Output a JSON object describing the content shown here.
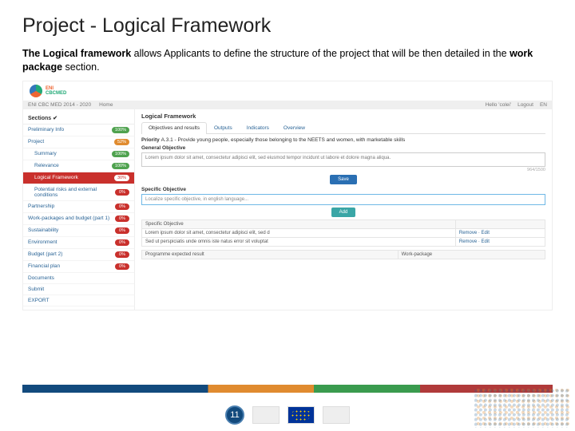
{
  "slide": {
    "title": "Project - Logical Framework",
    "intro_a": "The Logical framework",
    "intro_b": " allows Applicants to define the structure of the project that will be then detailed in the ",
    "intro_c": "work package",
    "intro_d": " section.",
    "page_number": "11"
  },
  "header": {
    "brand1": "ENI",
    "brand2": "CBCMED",
    "programme": "ENI CBC MED 2014 - 2020",
    "home": "Home",
    "hello": "Hello 'colei'",
    "logout": "Logout",
    "lang": "EN"
  },
  "sidebar": {
    "title": "Sections ✔",
    "items": [
      {
        "label": "Preliminary Info",
        "pct": "100%",
        "cls": "bg-green",
        "indent": false,
        "active": false
      },
      {
        "label": "Project",
        "pct": "52%",
        "cls": "bg-orange",
        "indent": false,
        "active": false
      },
      {
        "label": "Summary",
        "pct": "100%",
        "cls": "bg-green",
        "indent": true,
        "active": false
      },
      {
        "label": "Relevance",
        "pct": "100%",
        "cls": "bg-green",
        "indent": true,
        "active": false
      },
      {
        "label": "Logical Framework",
        "pct": "30%",
        "cls": "bg-white",
        "indent": true,
        "active": true
      },
      {
        "label": "Potential risks and external conditions",
        "pct": "0%",
        "cls": "bg-red",
        "indent": true,
        "active": false
      },
      {
        "label": "Partnership",
        "pct": "0%",
        "cls": "bg-red",
        "indent": false,
        "active": false
      },
      {
        "label": "Work-packages and budget (part 1)",
        "pct": "0%",
        "cls": "bg-red",
        "indent": false,
        "active": false
      },
      {
        "label": "Sustainability",
        "pct": "0%",
        "cls": "bg-red",
        "indent": false,
        "active": false
      },
      {
        "label": "Environment",
        "pct": "0%",
        "cls": "bg-red",
        "indent": false,
        "active": false
      },
      {
        "label": "Budget (part 2)",
        "pct": "0%",
        "cls": "bg-red",
        "indent": false,
        "active": false
      },
      {
        "label": "Financial plan",
        "pct": "0%",
        "cls": "bg-red",
        "indent": false,
        "active": false
      },
      {
        "label": "Documents",
        "pct": "",
        "cls": "",
        "indent": false,
        "active": false
      },
      {
        "label": "Submit",
        "pct": "",
        "cls": "",
        "indent": false,
        "active": false
      },
      {
        "label": "EXPORT",
        "pct": "",
        "cls": "",
        "indent": false,
        "active": false
      }
    ]
  },
  "main": {
    "panel": "Logical Framework",
    "tabs": [
      "Objectives and results",
      "Outputs",
      "Indicators",
      "Overview"
    ],
    "active_tab": 0,
    "priority_label": "Priority",
    "priority_text": "A.3.1 - Provide young people, especially those belonging to the NEETS and women, with marketable skills",
    "general_label": "General Objective",
    "general_text": "Lorem ipsum dolor sit amet, consectetur adipisci elit, sed eiusmod tempor incidunt ut labore et dolore magna aliqua.",
    "char_count": "964/1500",
    "save": "Save",
    "specific_label": "Specific Objective",
    "specific_placeholder": "Localize specific objective, in english language...",
    "add": "Add",
    "table": {
      "col1": "Specific Objective",
      "col2": "",
      "rows": [
        {
          "text": "Lorem ipsum dolor sit amet, consectetur adipisci elit, sed d",
          "actions": "Remove · Edit"
        },
        {
          "text": "Sed ut perspiciatis unde omnis iste natus error sit voluptat",
          "actions": "Remove · Edit"
        }
      ]
    },
    "bottom_col1": "Programme expected result",
    "bottom_col2": "Work-package"
  }
}
